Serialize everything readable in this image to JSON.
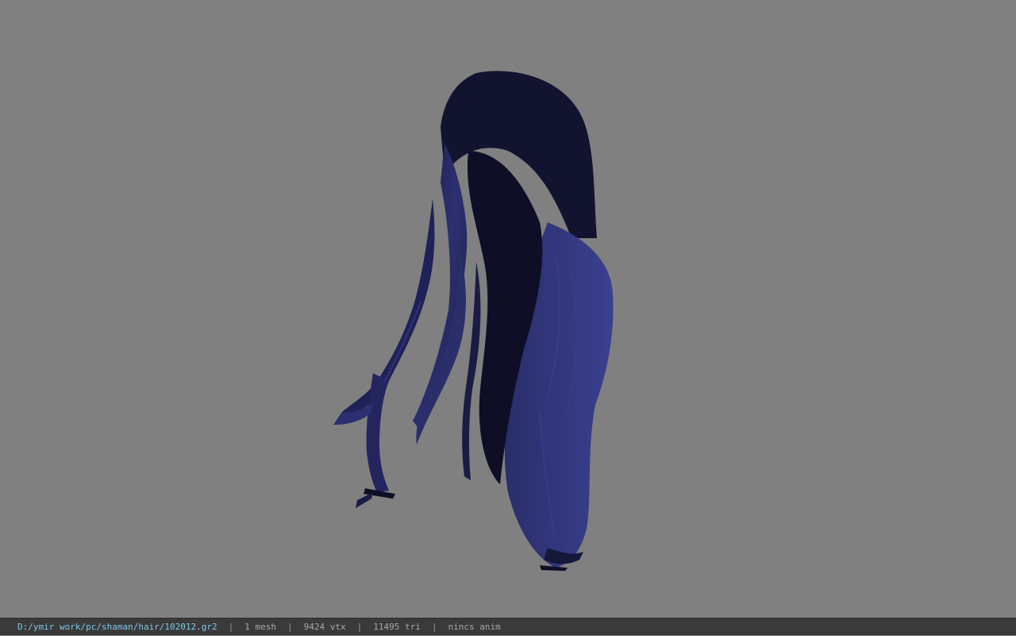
{
  "viewport": {
    "model_name": "hair-mesh",
    "background_color": "#808080",
    "model_color": "#2a2d63"
  },
  "status_bar": {
    "file_path": "D:/ymir work/pc/shaman/hair/102012.gr2",
    "separator": "|",
    "mesh_count": "1 mesh",
    "vertex_count": "9424 vtx",
    "triangle_count": "11495 tri",
    "anim_status": "nincs anim",
    "path_color": "#7fc7e8"
  }
}
